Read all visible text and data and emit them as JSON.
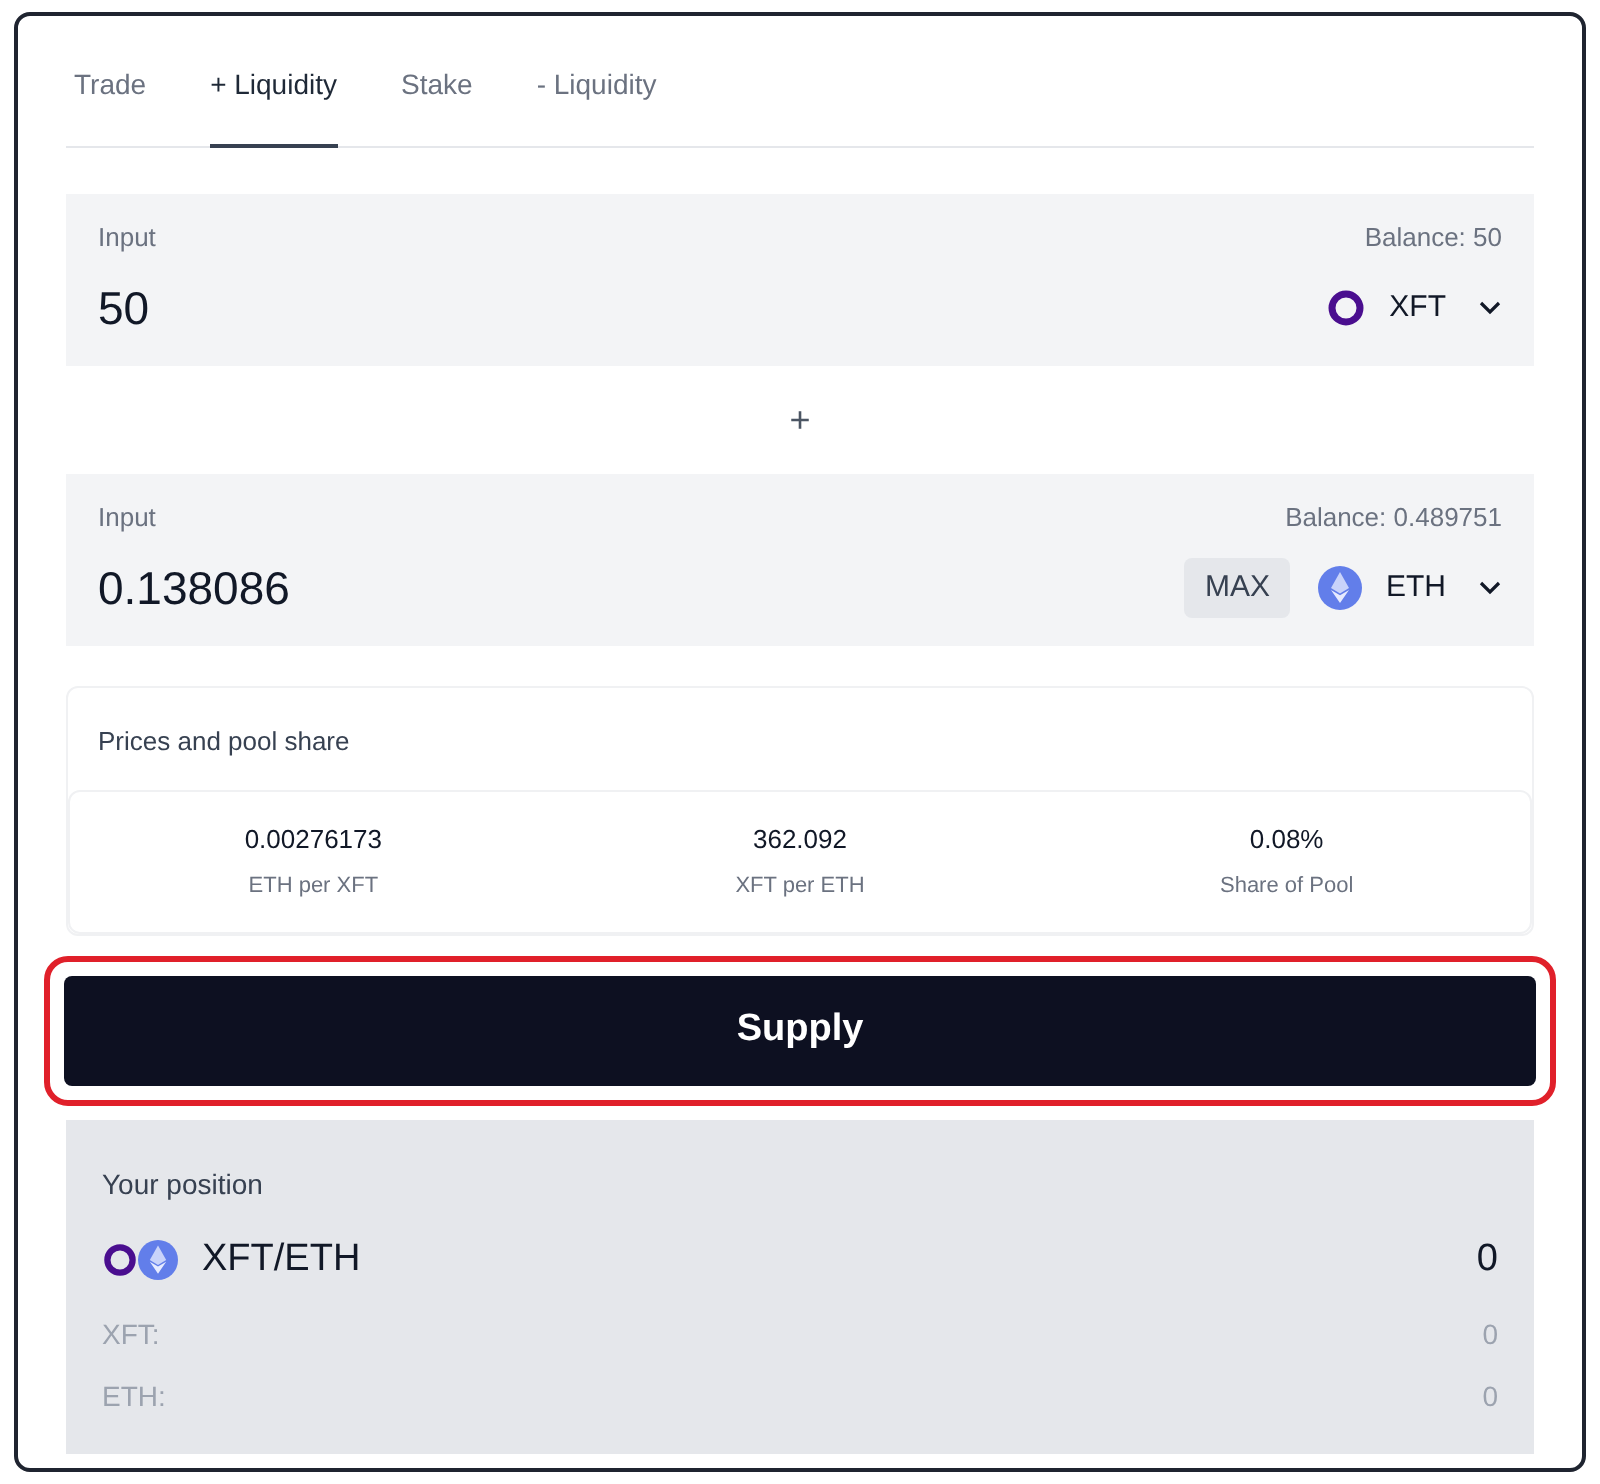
{
  "tabs": [
    {
      "label": "Trade",
      "selected": false
    },
    {
      "label": "+ Liquidity",
      "selected": true
    },
    {
      "label": "Stake",
      "selected": false
    },
    {
      "label": "- Liquidity",
      "selected": false
    }
  ],
  "inputs": [
    {
      "label": "Input",
      "balance": "Balance: 50",
      "value": "50",
      "token": {
        "kind": "xft",
        "symbol": "XFT"
      }
    },
    {
      "label": "Input",
      "balance": "Balance: 0.489751",
      "value": "0.138086",
      "max": "MAX",
      "token": {
        "kind": "eth",
        "symbol": "ETH"
      }
    }
  ],
  "plus": "+",
  "prices": {
    "title": "Prices and pool share",
    "stats": [
      {
        "value": "0.00276173",
        "label": "ETH per XFT"
      },
      {
        "value": "362.092",
        "label": "XFT per ETH"
      },
      {
        "value": "0.08%",
        "label": "Share of Pool"
      }
    ]
  },
  "supply_button": {
    "label": "Supply",
    "highlighted": true
  },
  "position": {
    "title": "Your position",
    "pair": "XFT/ETH",
    "amount": "0",
    "rows": [
      {
        "label": "XFT:",
        "value": "0"
      },
      {
        "label": "ETH:",
        "value": "0"
      }
    ]
  }
}
